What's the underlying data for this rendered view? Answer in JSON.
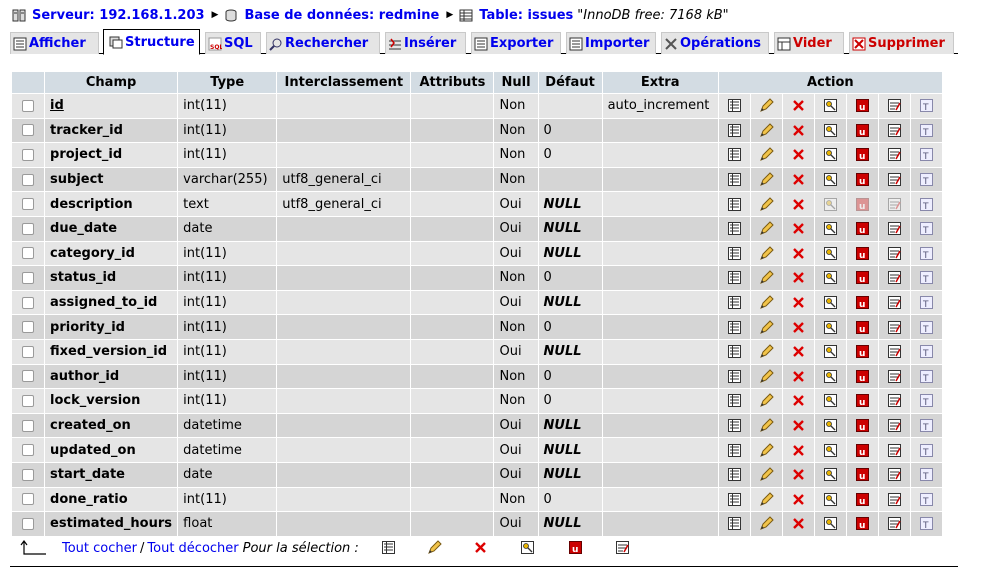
{
  "breadcrumb": {
    "server": "Serveur: 192.168.1.203",
    "database": "Base de données: redmine",
    "table": "Table: issues",
    "note": "\"InnoDB free: 7168 kB\""
  },
  "tabs": [
    "Afficher",
    "Structure",
    "SQL",
    "Rechercher",
    "Insérer",
    "Exporter",
    "Importer",
    "Opérations",
    "Vider",
    "Supprimer"
  ],
  "active_tab": "Structure",
  "columns": [
    "Champ",
    "Type",
    "Interclassement",
    "Attributs",
    "Null",
    "Défaut",
    "Extra",
    "Action"
  ],
  "rows": [
    {
      "name": "id",
      "type": "int(11)",
      "collation": "",
      "attributes": "",
      "null": "Non",
      "default": "",
      "extra": "auto_increment"
    },
    {
      "name": "tracker_id",
      "type": "int(11)",
      "collation": "",
      "attributes": "",
      "null": "Non",
      "default": "0",
      "extra": ""
    },
    {
      "name": "project_id",
      "type": "int(11)",
      "collation": "",
      "attributes": "",
      "null": "Non",
      "default": "0",
      "extra": ""
    },
    {
      "name": "subject",
      "type": "varchar(255)",
      "collation": "utf8_general_ci",
      "attributes": "",
      "null": "Non",
      "default": "",
      "extra": ""
    },
    {
      "name": "description",
      "type": "text",
      "collation": "utf8_general_ci",
      "attributes": "",
      "null": "Oui",
      "default": "NULL",
      "extra": ""
    },
    {
      "name": "due_date",
      "type": "date",
      "collation": "",
      "attributes": "",
      "null": "Oui",
      "default": "NULL",
      "extra": ""
    },
    {
      "name": "category_id",
      "type": "int(11)",
      "collation": "",
      "attributes": "",
      "null": "Oui",
      "default": "NULL",
      "extra": ""
    },
    {
      "name": "status_id",
      "type": "int(11)",
      "collation": "",
      "attributes": "",
      "null": "Non",
      "default": "0",
      "extra": ""
    },
    {
      "name": "assigned_to_id",
      "type": "int(11)",
      "collation": "",
      "attributes": "",
      "null": "Oui",
      "default": "NULL",
      "extra": ""
    },
    {
      "name": "priority_id",
      "type": "int(11)",
      "collation": "",
      "attributes": "",
      "null": "Non",
      "default": "0",
      "extra": ""
    },
    {
      "name": "fixed_version_id",
      "type": "int(11)",
      "collation": "",
      "attributes": "",
      "null": "Oui",
      "default": "NULL",
      "extra": ""
    },
    {
      "name": "author_id",
      "type": "int(11)",
      "collation": "",
      "attributes": "",
      "null": "Non",
      "default": "0",
      "extra": ""
    },
    {
      "name": "lock_version",
      "type": "int(11)",
      "collation": "",
      "attributes": "",
      "null": "Non",
      "default": "0",
      "extra": ""
    },
    {
      "name": "created_on",
      "type": "datetime",
      "collation": "",
      "attributes": "",
      "null": "Oui",
      "default": "NULL",
      "extra": ""
    },
    {
      "name": "updated_on",
      "type": "datetime",
      "collation": "",
      "attributes": "",
      "null": "Oui",
      "default": "NULL",
      "extra": ""
    },
    {
      "name": "start_date",
      "type": "date",
      "collation": "",
      "attributes": "",
      "null": "Oui",
      "default": "NULL",
      "extra": ""
    },
    {
      "name": "done_ratio",
      "type": "int(11)",
      "collation": "",
      "attributes": "",
      "null": "Non",
      "default": "0",
      "extra": ""
    },
    {
      "name": "estimated_hours",
      "type": "float",
      "collation": "",
      "attributes": "",
      "null": "Oui",
      "default": "NULL",
      "extra": ""
    }
  ],
  "action_icons": [
    "browse-distinct-icon",
    "edit-pencil-icon",
    "drop-x-icon",
    "primary-key-icon",
    "unique-icon",
    "index-icon",
    "fulltext-icon"
  ],
  "footer": {
    "check_all": "Tout cocher",
    "separator": "/",
    "uncheck_all": "Tout décocher",
    "for_selection": "Pour la sélection :"
  },
  "colors": {
    "link": "#0000ee",
    "header_bg": "#d3dce3",
    "row_odd": "#e5e5e5",
    "row_even": "#d5d5d5",
    "danger": "#cc0000"
  }
}
